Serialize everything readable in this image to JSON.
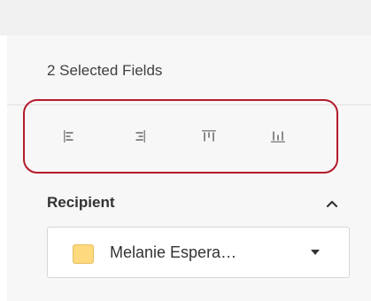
{
  "panel": {
    "selected_count_label": "2 Selected Fields"
  },
  "alignment_toolbar": {
    "buttons": [
      {
        "name": "align-left",
        "icon": "align-left-icon"
      },
      {
        "name": "align-right",
        "icon": "align-right-icon"
      },
      {
        "name": "align-top",
        "icon": "align-top-icon"
      },
      {
        "name": "align-bottom",
        "icon": "align-bottom-icon"
      }
    ],
    "highlight_color": "#b31b2a",
    "icon_color": "#8a8a8a"
  },
  "recipient": {
    "section_title": "Recipient",
    "collapse_icon": "chevron-up-icon",
    "selected_name": "Melanie Espera…",
    "swatch_color": "#ffd97d",
    "dropdown_icon": "caret-down-icon"
  }
}
